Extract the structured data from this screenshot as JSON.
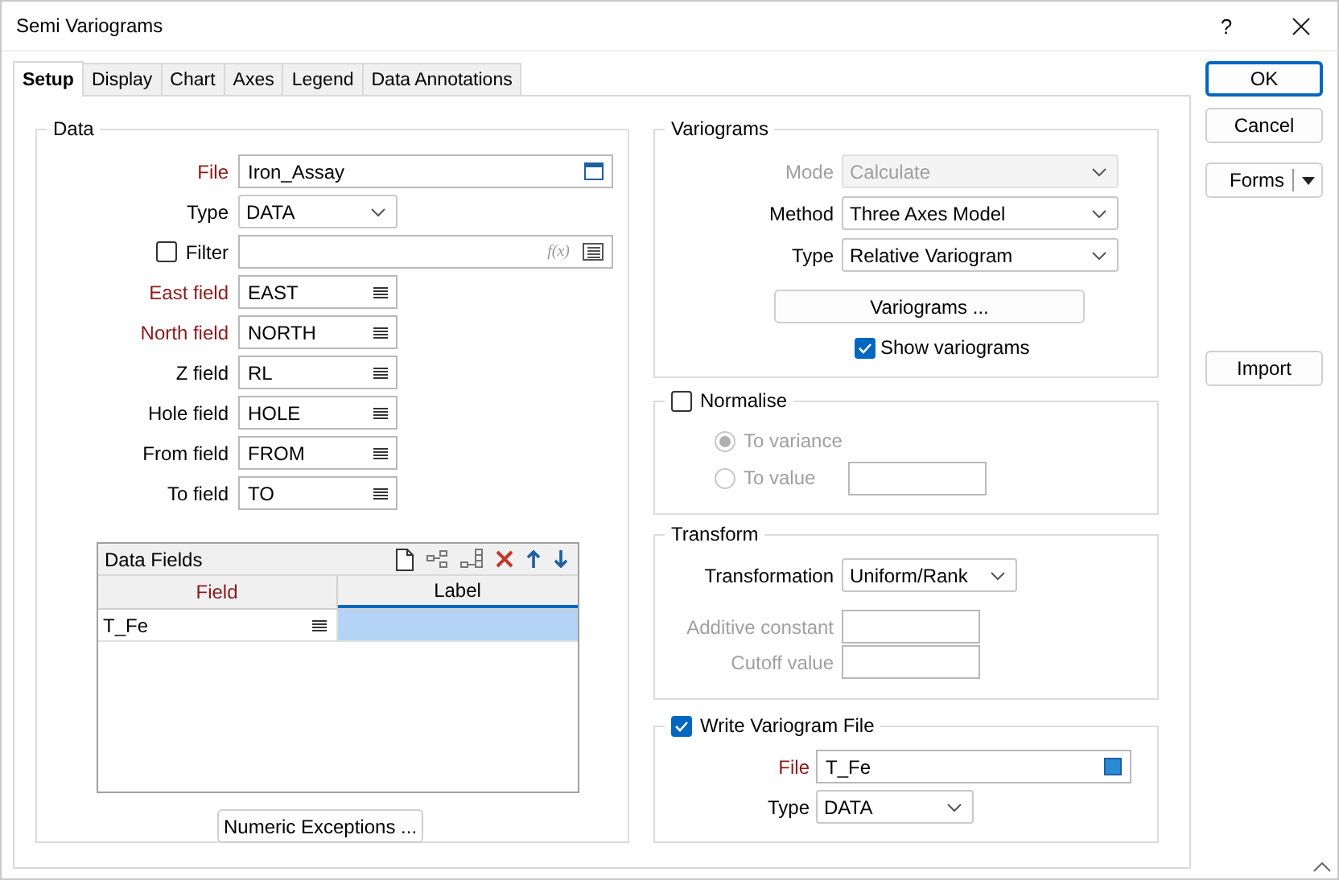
{
  "window": {
    "title": "Semi Variograms",
    "help": "?"
  },
  "tabs": [
    {
      "label": "Setup",
      "selected": true
    },
    {
      "label": "Display",
      "selected": false
    },
    {
      "label": "Chart",
      "selected": false
    },
    {
      "label": "Axes",
      "selected": false
    },
    {
      "label": "Legend",
      "selected": false
    },
    {
      "label": "Data Annotations",
      "selected": false
    }
  ],
  "data": {
    "title": "Data",
    "rows": [
      {
        "kind": "file",
        "label": "File",
        "required": true,
        "value": "Iron_Assay"
      },
      {
        "kind": "dropdown",
        "label": "Type",
        "required": false,
        "value": "DATA"
      },
      {
        "kind": "filter",
        "label": "Filter",
        "checked": false,
        "expression": "f(x)"
      },
      {
        "kind": "field",
        "label": "East field",
        "required": true,
        "value": "EAST"
      },
      {
        "kind": "field",
        "label": "North field",
        "required": true,
        "value": "NORTH"
      },
      {
        "kind": "field",
        "label": "Z field",
        "required": false,
        "value": "RL"
      },
      {
        "kind": "field",
        "label": "Hole field",
        "required": false,
        "value": "HOLE"
      },
      {
        "kind": "field",
        "label": "From field",
        "required": false,
        "value": "FROM"
      },
      {
        "kind": "field",
        "label": "To field",
        "required": false,
        "value": "TO"
      }
    ]
  },
  "data_fields": {
    "title": "Data Fields",
    "columns": [
      {
        "label": "Field",
        "required": true,
        "selected": false
      },
      {
        "label": "Label",
        "required": false,
        "selected": true
      }
    ],
    "rows": [
      {
        "field": "T_Fe",
        "selected": true
      }
    ]
  },
  "numeric_exceptions": "Numeric Exceptions ...",
  "variograms": {
    "title": "Variograms",
    "rows": [
      {
        "label": "Mode",
        "value": "Calculate",
        "disabled": true
      },
      {
        "label": "Method",
        "value": "Three Axes Model",
        "disabled": false
      },
      {
        "label": "Type",
        "value": "Relative Variogram",
        "disabled": false
      }
    ],
    "button": "Variograms ...",
    "show": {
      "label": "Show variograms",
      "checked": true
    }
  },
  "normalise": {
    "label": "Normalise",
    "checked": false,
    "options": [
      {
        "label": "To variance",
        "selected": true,
        "disabled": true
      },
      {
        "label": "To value",
        "selected": false,
        "disabled": true
      }
    ]
  },
  "transform": {
    "title": "Transform",
    "transformation": {
      "label": "Transformation",
      "value": "Uniform/Rank"
    },
    "inputs": [
      {
        "label": "Additive constant",
        "disabled": true
      },
      {
        "label": "Cutoff value",
        "disabled": true
      }
    ]
  },
  "write_file": {
    "label": "Write Variogram File",
    "checked": true,
    "file": {
      "label": "File",
      "required": true,
      "value": "T_Fe"
    },
    "type": {
      "label": "Type",
      "value": "DATA"
    }
  },
  "buttons": [
    {
      "label": "OK",
      "kind": "default"
    },
    {
      "label": "Cancel",
      "kind": "plain"
    },
    {
      "label": "Forms",
      "kind": "split"
    },
    {
      "label": "Import",
      "kind": "plain"
    }
  ]
}
